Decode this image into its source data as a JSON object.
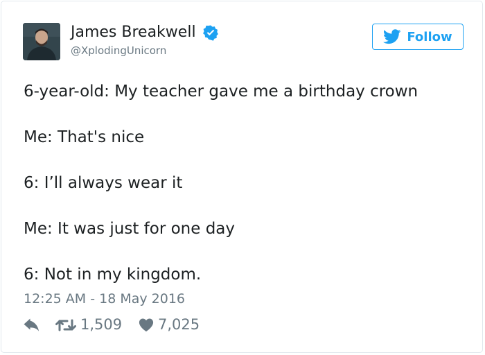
{
  "author": {
    "name": "James Breakwell",
    "handle": "@XplodingUnicorn",
    "verified": true
  },
  "follow_button": {
    "label": "Follow"
  },
  "tweet": {
    "lines": [
      "6-year-old: My teacher gave me a birthday crown",
      "Me: That's nice",
      "6: I’ll always wear it",
      "Me: It was just for one day",
      "6: Not in my kingdom."
    ],
    "timestamp": "12:25 AM - 18 May 2016"
  },
  "stats": {
    "retweets": "1,509",
    "likes": "7,025"
  },
  "colors": {
    "accent": "#1da1f2",
    "text": "#1c2022",
    "muted": "#697882",
    "border": "#e1e8ed"
  },
  "icons": [
    "verified-badge-icon",
    "twitter-bird-icon",
    "reply-icon",
    "retweet-icon",
    "heart-icon"
  ]
}
